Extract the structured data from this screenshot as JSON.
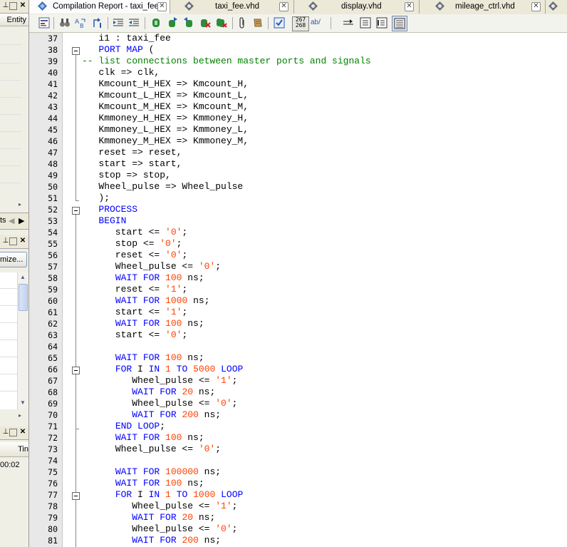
{
  "left_panel": {
    "entity_header": "Entity",
    "tabs_fragment": "ts",
    "customize_button": "mize...",
    "time_header": "Tin",
    "time_value": "00:02"
  },
  "tabs": [
    {
      "label": "Compilation Report - taxi_fee",
      "active": true
    },
    {
      "label": "taxi_fee.vhd",
      "active": false
    },
    {
      "label": "display.vhd",
      "active": false
    },
    {
      "label": "mileage_ctrl.vhd",
      "active": false
    }
  ],
  "toolbar": {
    "line_count_top": "267",
    "line_count_bottom": "268",
    "ab_label": "ab/"
  },
  "editor": {
    "lines": [
      {
        "n": "37",
        "html": "   i1 : taxi_fee"
      },
      {
        "n": "38",
        "html": "   <span class=\"kw\">PORT MAP</span> ("
      },
      {
        "n": "39",
        "html": "<span class=\"cmt\">-- list connections between master ports and signals</span>"
      },
      {
        "n": "40",
        "html": "   clk =&gt; clk,"
      },
      {
        "n": "41",
        "html": "   Kmcount_H_HEX =&gt; Kmcount_H,"
      },
      {
        "n": "42",
        "html": "   Kmcount_L_HEX =&gt; Kmcount_L,"
      },
      {
        "n": "43",
        "html": "   Kmcount_M_HEX =&gt; Kmcount_M,"
      },
      {
        "n": "44",
        "html": "   Kmmoney_H_HEX =&gt; Kmmoney_H,"
      },
      {
        "n": "45",
        "html": "   Kmmoney_L_HEX =&gt; Kmmoney_L,"
      },
      {
        "n": "46",
        "html": "   Kmmoney_M_HEX =&gt; Kmmoney_M,"
      },
      {
        "n": "47",
        "html": "   reset =&gt; reset,"
      },
      {
        "n": "48",
        "html": "   start =&gt; start,"
      },
      {
        "n": "49",
        "html": "   stop =&gt; stop,"
      },
      {
        "n": "50",
        "html": "   Wheel_pulse =&gt; Wheel_pulse"
      },
      {
        "n": "51",
        "html": "   );"
      },
      {
        "n": "52",
        "html": "   <span class=\"kw\">PROCESS</span>"
      },
      {
        "n": "53",
        "html": "   <span class=\"kw\">BEGIN</span>"
      },
      {
        "n": "54",
        "html": "      start &lt;= <span class=\"str\">'0'</span>;"
      },
      {
        "n": "55",
        "html": "      stop &lt;= <span class=\"str\">'0'</span>;"
      },
      {
        "n": "56",
        "html": "      reset &lt;= <span class=\"str\">'0'</span>;"
      },
      {
        "n": "57",
        "html": "      Wheel_pulse &lt;= <span class=\"str\">'0'</span>;"
      },
      {
        "n": "58",
        "html": "      <span class=\"kw\">WAIT FOR</span> <span class=\"num\">100</span> ns;"
      },
      {
        "n": "59",
        "html": "      reset &lt;= <span class=\"str\">'1'</span>;"
      },
      {
        "n": "60",
        "html": "      <span class=\"kw\">WAIT FOR</span> <span class=\"num\">1000</span> ns;"
      },
      {
        "n": "61",
        "html": "      start &lt;= <span class=\"str\">'1'</span>;"
      },
      {
        "n": "62",
        "html": "      <span class=\"kw\">WAIT FOR</span> <span class=\"num\">100</span> ns;"
      },
      {
        "n": "63",
        "html": "      start &lt;= <span class=\"str\">'0'</span>;"
      },
      {
        "n": "64",
        "html": ""
      },
      {
        "n": "65",
        "html": "      <span class=\"kw\">WAIT FOR</span> <span class=\"num\">100</span> ns;"
      },
      {
        "n": "66",
        "html": "      <span class=\"kw\">FOR</span> I <span class=\"kw\">IN</span> <span class=\"num\">1</span> <span class=\"kw\">TO</span> <span class=\"num\">5000</span> <span class=\"kw\">LOOP</span>"
      },
      {
        "n": "67",
        "html": "         Wheel_pulse &lt;= <span class=\"str\">'1'</span>;"
      },
      {
        "n": "68",
        "html": "         <span class=\"kw\">WAIT FOR</span> <span class=\"num\">20</span> ns;"
      },
      {
        "n": "69",
        "html": "         Wheel_pulse &lt;= <span class=\"str\">'0'</span>;"
      },
      {
        "n": "70",
        "html": "         <span class=\"kw\">WAIT FOR</span> <span class=\"num\">200</span> ns;"
      },
      {
        "n": "71",
        "html": "      <span class=\"kw\">END LOOP</span>;"
      },
      {
        "n": "72",
        "html": "      <span class=\"kw\">WAIT FOR</span> <span class=\"num\">100</span> ns;"
      },
      {
        "n": "73",
        "html": "      Wheel_pulse &lt;= <span class=\"str\">'0'</span>;"
      },
      {
        "n": "74",
        "html": ""
      },
      {
        "n": "75",
        "html": "      <span class=\"kw\">WAIT FOR</span> <span class=\"num\">100000</span> ns;"
      },
      {
        "n": "76",
        "html": "      <span class=\"kw\">WAIT FOR</span> <span class=\"num\">100</span> ns;"
      },
      {
        "n": "77",
        "html": "      <span class=\"kw\">FOR</span> I <span class=\"kw\">IN</span> <span class=\"num\">1</span> <span class=\"kw\">TO</span> <span class=\"num\">1000</span> <span class=\"kw\">LOOP</span>"
      },
      {
        "n": "78",
        "html": "         Wheel_pulse &lt;= <span class=\"str\">'1'</span>;"
      },
      {
        "n": "79",
        "html": "         <span class=\"kw\">WAIT FOR</span> <span class=\"num\">20</span> ns;"
      },
      {
        "n": "80",
        "html": "         Wheel_pulse &lt;= <span class=\"str\">'0'</span>;"
      },
      {
        "n": "81",
        "html": "         <span class=\"kw\">WAIT FOR</span> <span class=\"num\">200</span> ns;"
      }
    ]
  },
  "colors": {
    "keyword": "#0000ff",
    "number": "#ff4000",
    "comment": "#008000"
  }
}
